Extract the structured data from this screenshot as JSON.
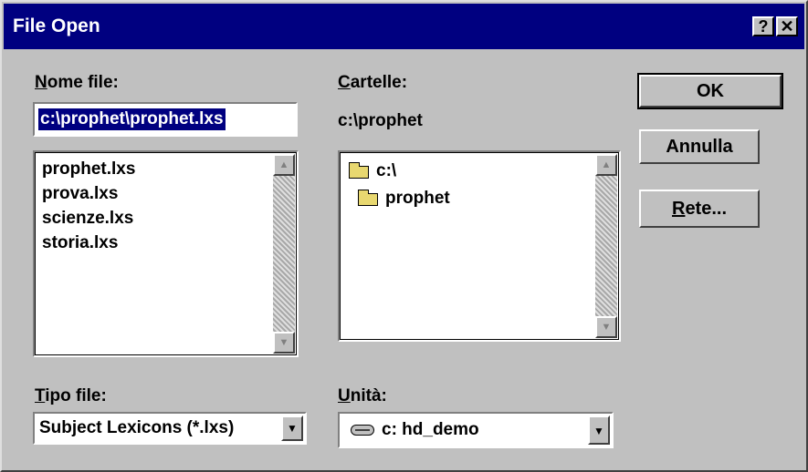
{
  "window": {
    "title": "File Open",
    "help_glyph": "?",
    "close_glyph": "✕"
  },
  "file_name": {
    "label_mnemonic": "N",
    "label_rest": "ome file:",
    "value": "c:\\prophet\\prophet.lxs",
    "files": [
      "prophet.lxs",
      "prova.lxs",
      "scienze.lxs",
      "storia.lxs"
    ]
  },
  "folders": {
    "label_mnemonic": "C",
    "label_rest": "artelle:",
    "current_path": "c:\\prophet",
    "tree": [
      {
        "name": "c:\\"
      },
      {
        "name": "prophet"
      }
    ]
  },
  "file_type": {
    "label_mnemonic": "T",
    "label_rest": "ipo file:",
    "selected": "Subject Lexicons (*.lxs)"
  },
  "drives": {
    "label_mnemonic": "U",
    "label_rest": "nità:",
    "selected": "c: hd_demo"
  },
  "buttons": {
    "ok": "OK",
    "cancel": "Annulla",
    "network_mnemonic": "R",
    "network_rest": "ete..."
  },
  "glyphs": {
    "scroll_up": "▲",
    "scroll_down": "▼",
    "dropdown": "▼"
  },
  "colors": {
    "titlebar": "#000080",
    "selection": "#000080",
    "face": "#c0c0c0"
  }
}
